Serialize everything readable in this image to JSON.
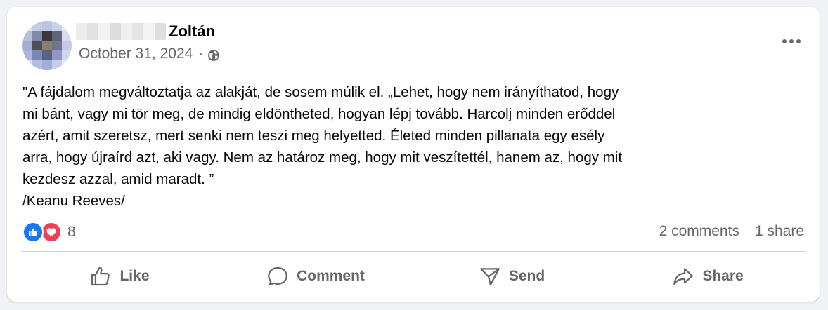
{
  "post": {
    "author_visible_name": "Zoltán",
    "date": "October 31, 2024",
    "separator": "·",
    "privacy_icon": "globe-icon",
    "more_icon": "more-options-icon",
    "text_lines": [
      "\"A fájdalom megváltoztatja az alakját, de sosem múlik el. „Lehet, hogy nem irányíthatod, hogy",
      "mi bánt, vagy mi tör meg, de mindig eldöntheted, hogyan lépj tovább. Harcolj minden erőddel",
      "azért, amit szeretsz, mert senki nem teszi meg helyetted. Életed minden pillanata egy esély",
      "arra, hogy újraírd azt, aki vagy. Nem az határoz meg, hogy mit veszítettél, hanem az, hogy mit",
      "kezdesz azzal, amid maradt. ”",
      "/Keanu Reeves/"
    ]
  },
  "stats": {
    "reaction_count": "8",
    "comments": "2 comments",
    "shares": "1 share"
  },
  "actions": {
    "like": "Like",
    "comment": "Comment",
    "send": "Send",
    "share": "Share"
  },
  "colors": {
    "like_blue": "#1877f2",
    "love_red": "#f33e58",
    "secondary_text": "#65676b"
  }
}
